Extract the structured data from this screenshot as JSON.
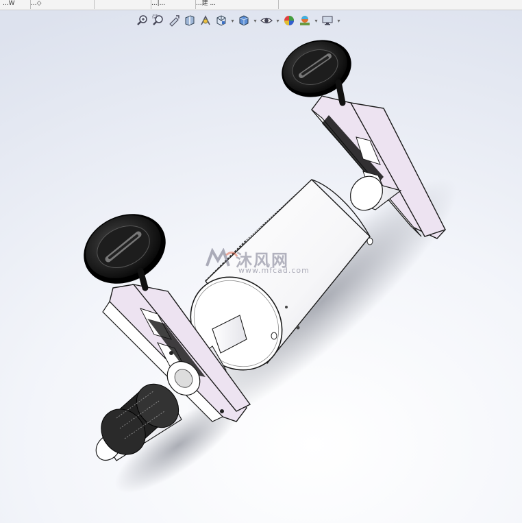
{
  "top_tabs": [
    {
      "label": "...W"
    },
    {
      "label": "...◇"
    },
    {
      "label": ""
    },
    {
      "label": "...|..."
    },
    {
      "label": "...建 ..."
    }
  ],
  "heads_up_toolbar": [
    {
      "icon": "zoom-to-fit-icon",
      "has_menu": false
    },
    {
      "icon": "zoom-to-area-icon",
      "has_menu": false
    },
    {
      "icon": "previous-view-icon",
      "has_menu": false
    },
    {
      "icon": "section-view-icon",
      "has_menu": false
    },
    {
      "icon": "dynamic-annotation-icon",
      "has_menu": false
    },
    {
      "icon": "view-orientation-icon",
      "has_menu": true
    },
    {
      "icon": "display-style-icon",
      "has_menu": true
    },
    {
      "icon": "hide-show-items-icon",
      "has_menu": true
    },
    {
      "icon": "edit-appearance-icon",
      "has_menu": false
    },
    {
      "icon": "apply-scene-icon",
      "has_menu": true
    },
    {
      "icon": "view-settings-icon",
      "has_menu": true
    }
  ],
  "watermark": {
    "brand_cn": "沐风网",
    "url": "www.mfcad.com"
  },
  "colors": {
    "frame": "#ede3f1",
    "frame_edge": "#1a1a1a",
    "drum": "#ffffff",
    "handwheel": "#111111",
    "background_center": "#ffffff",
    "background_edge": "#dde2ee"
  }
}
